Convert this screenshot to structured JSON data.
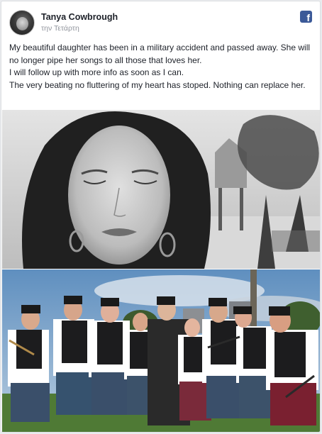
{
  "post": {
    "author_name": "Tanya Cowbrough",
    "timestamp": "την Τετάρτη",
    "platform_icon": "facebook-icon",
    "platform_icon_glyph": "f",
    "paragraphs": [
      "My beautiful daughter has been in a military accident and passed away. She will no longer pipe her songs to all those that loves her.",
      "I will follow up with more info as soon as I can.",
      "The very beating no fluttering of my heart has stoped. Nothing can replace her."
    ]
  },
  "colors": {
    "facebook_blue": "#3b5998",
    "name_text": "#1d2129",
    "meta_text": "#90949c"
  }
}
